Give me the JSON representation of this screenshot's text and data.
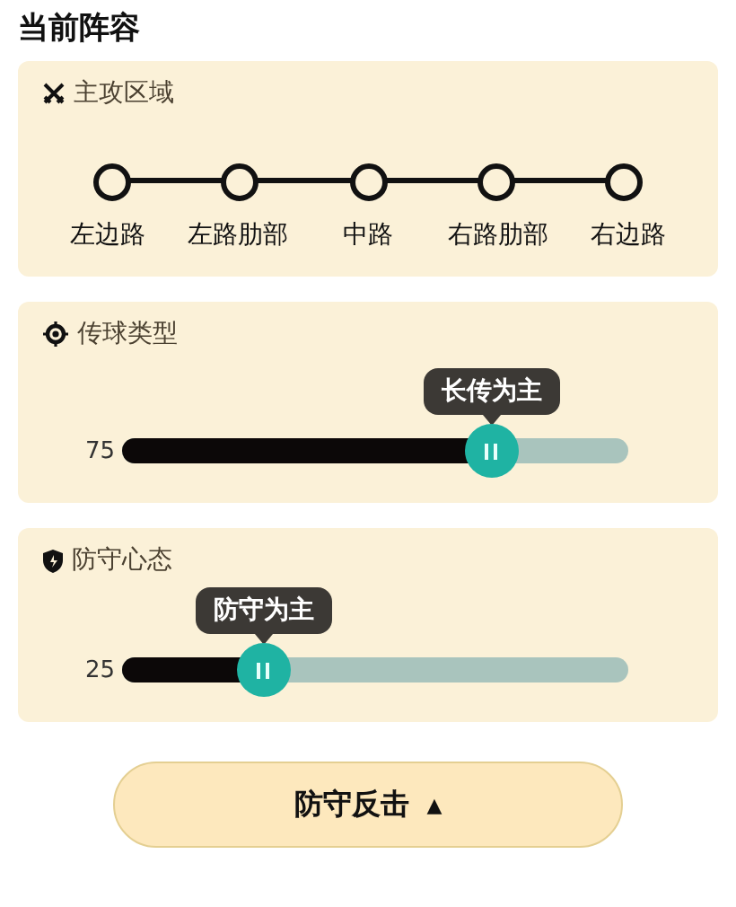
{
  "title": "当前阵容",
  "sections": [
    {
      "kind": "track",
      "label": "主攻区域",
      "points": [
        "左边路",
        "左路肋部",
        "中路",
        "右路肋部",
        "右边路"
      ]
    },
    {
      "kind": "slider",
      "label": "传球类型",
      "reading": "75",
      "level": 0.73,
      "tooltip": "长传为主"
    },
    {
      "kind": "slider",
      "label": "防守心态",
      "reading": "25",
      "level": 0.28,
      "tooltip": "防守为主"
    }
  ],
  "button": {
    "label": "防守反击",
    "caret": "▲"
  }
}
